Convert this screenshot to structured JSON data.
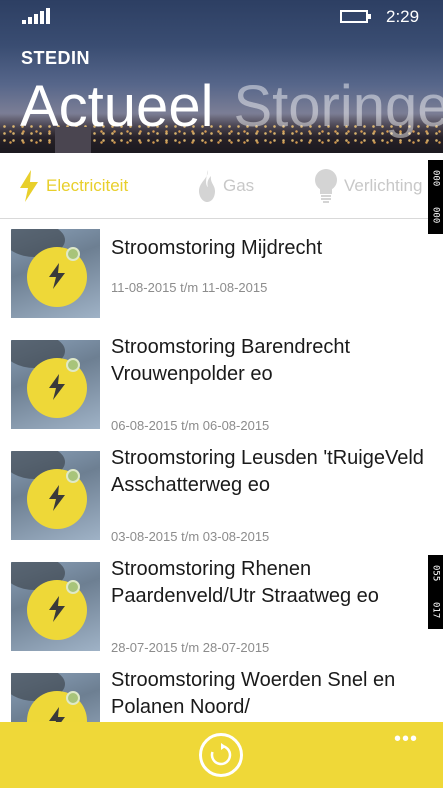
{
  "status_bar": {
    "time": "2:29",
    "signal": "signal-bars-icon",
    "battery": "battery-charging-icon"
  },
  "app": {
    "name": "STEDIN"
  },
  "pivot": {
    "active": "Actueel",
    "next": "Storinge"
  },
  "tabs": [
    {
      "label": "Electriciteit",
      "icon": "lightning-icon",
      "selected": true
    },
    {
      "label": "Gas",
      "icon": "flame-icon",
      "selected": false
    },
    {
      "label": "Verlichting",
      "icon": "lightbulb-icon",
      "selected": false
    }
  ],
  "outages": [
    {
      "title": "Stroomstoring Mijdrecht",
      "date": "11-08-2015 t/m 11-08-2015"
    },
    {
      "title": "Stroomstoring Barendrecht Vrouwenpolder eo",
      "date": "06-08-2015 t/m 06-08-2015"
    },
    {
      "title": "Stroomstoring Leusden 'tRuigeVeld Asschatterweg eo",
      "date": "03-08-2015 t/m 03-08-2015"
    },
    {
      "title": "Stroomstoring Rhenen Paardenveld/Utr Straatweg eo",
      "date": "28-07-2015 t/m 28-07-2015"
    },
    {
      "title": "Stroomstoring Woerden Snel en Polanen Noord/",
      "date": ""
    }
  ],
  "appbar": {
    "refresh_icon": "refresh-icon",
    "more": "•••"
  },
  "edge_overlays": {
    "top": [
      "000",
      "000"
    ],
    "bottom": [
      "055",
      "017"
    ]
  },
  "colors": {
    "accent": "#efd838",
    "tab_active": "#e8cf2b",
    "tab_inactive": "#c8c8c8"
  }
}
